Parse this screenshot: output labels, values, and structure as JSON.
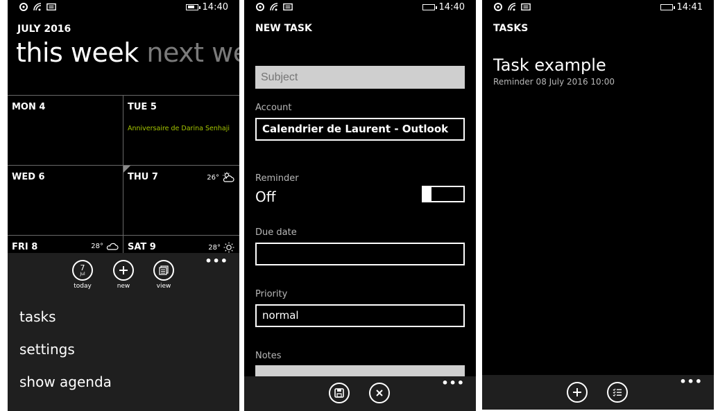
{
  "panel1": {
    "status": {
      "time": "14:40"
    },
    "month": "JULY 2016",
    "pivot": {
      "active": "this week",
      "inactive": "next wee"
    },
    "days": [
      {
        "label": "MON 4"
      },
      {
        "label": "TUE 5",
        "event": "Anniversaire de Darina Senhaji"
      },
      {
        "label": "WED 6"
      },
      {
        "label": "THU 7",
        "temp": "26°",
        "weather_icon": "partly-sunny-icon"
      },
      {
        "label": "FRI 8",
        "temp": "28°",
        "weather_icon": "cloud-icon"
      },
      {
        "label": "SAT 9",
        "temp": "28°",
        "weather_icon": "sun-icon"
      }
    ],
    "appbar": {
      "dots": "•••",
      "today_day": "7",
      "today_month": "Jul",
      "today_label": "today",
      "new_label": "new",
      "view_label": "view"
    },
    "menu": [
      "tasks",
      "settings",
      "show agenda"
    ]
  },
  "panel2": {
    "status": {
      "time": "14:40"
    },
    "title": "NEW TASK",
    "subject_placeholder": "Subject",
    "account_label": "Account",
    "account_value": "Calendrier de Laurent - Outlook",
    "reminder_label": "Reminder",
    "reminder_value": "Off",
    "due_label": "Due date",
    "due_value": "",
    "priority_label": "Priority",
    "priority_value": "normal",
    "notes_label": "Notes",
    "dots": "•••"
  },
  "panel3": {
    "status": {
      "time": "14:41"
    },
    "title": "TASKS",
    "task": {
      "title": "Task example",
      "reminder": "Reminder 08 July 2016 10:00"
    },
    "dots": "•••"
  }
}
